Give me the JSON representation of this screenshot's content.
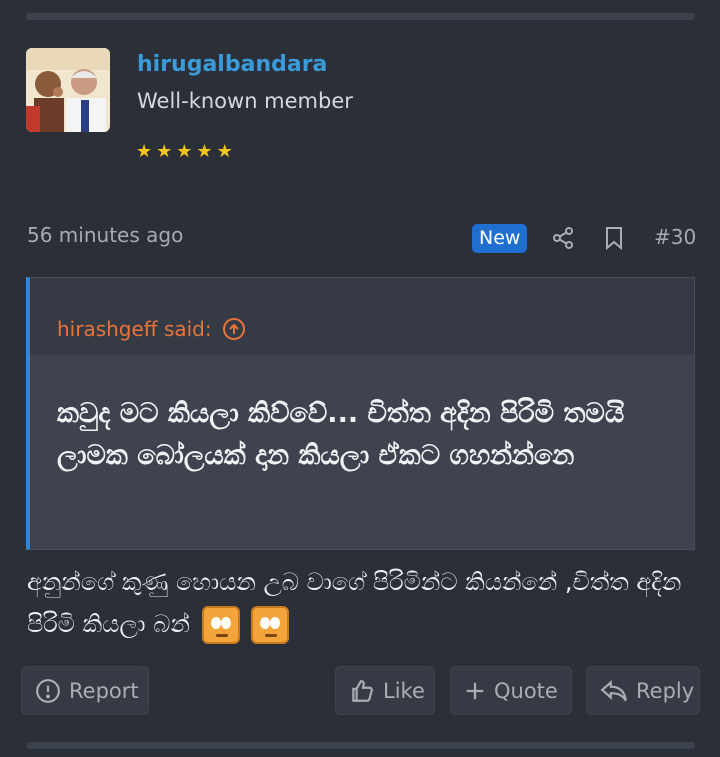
{
  "user": {
    "name": "hirugalbandara",
    "title": "Well-known member",
    "rating_stars": 5
  },
  "post": {
    "time": "56 minutes ago",
    "badge": "New",
    "number": "#30"
  },
  "quote": {
    "author": "hirashgeff said:",
    "text": "කවුද මට කියලා කිව්වේ... චිත්ත අදින පිරිමි තමයි ලාමක බෝලයක් දාන කියලා ඒකට ගහන්න්නෙ"
  },
  "message": {
    "text": "අනුන්ගේ කුණු හොයන උබ වාගේ පිරිමින්ට කියන්නේ ,චිත්ත අදින පිරිමි කියලා බන්"
  },
  "actions": {
    "report": "Report",
    "like": "Like",
    "quote": "Quote",
    "reply": "Reply"
  },
  "colors": {
    "accent_blue": "#3b9bd9",
    "badge_blue": "#1f6fd1",
    "quote_orange": "#e8743b",
    "star_yellow": "#f5c518"
  }
}
